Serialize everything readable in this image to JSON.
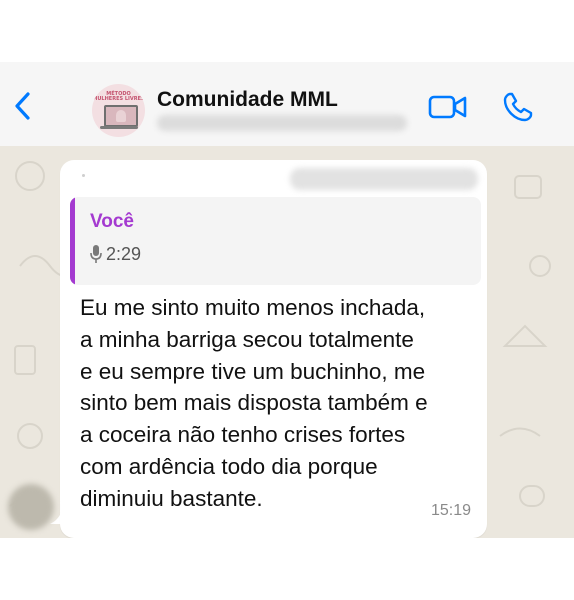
{
  "header": {
    "back_icon": "chevron-left-icon",
    "title": "Comunidade MML",
    "avatar_text": "MÉTODO MULHERES LIVRES",
    "accent_color": "#007aff"
  },
  "message": {
    "quoted": {
      "author": "Você",
      "duration": "2:29",
      "accent_color": "#a43ad0"
    },
    "lines": [
      "Eu me sinto muito menos inchada,",
      "a minha barriga secou totalmente",
      "e eu sempre tive um buchinho, me",
      "sinto bem mais disposta também e",
      "a coceira não tenho crises fortes",
      "com ardência todo dia porque",
      "diminuiu bastante."
    ],
    "time": "15:19"
  }
}
